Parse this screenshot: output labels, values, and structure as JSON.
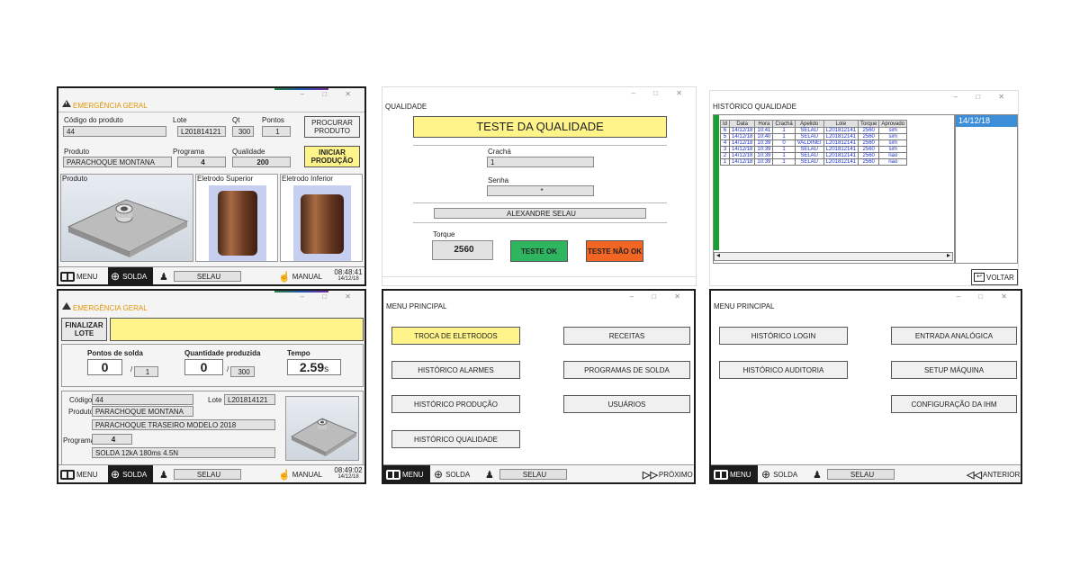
{
  "p1": {
    "alert": "EMERGÊNCIA GERAL",
    "codigo_label": "Código do produto",
    "codigo_value": "44",
    "lote_label": "Lote",
    "lote_value": "L201814121",
    "qt_label": "Qt",
    "qt_value": "300",
    "pontos_label": "Pontos",
    "pontos_value": "1",
    "procurar": "PROCURAR PRODUTO",
    "produto_label": "Produto",
    "produto_value": "PARACHOQUE MONTANA",
    "programa_label": "Programa",
    "programa_value": "4",
    "qualidade_label": "Qualidade",
    "qualidade_value": "200",
    "iniciar": "INICIAR PRODUÇÃO",
    "img_produto": "Produto",
    "img_sup": "Eletrodo Superior",
    "img_inf": "Eletrodo Inferior",
    "status": {
      "menu": "MENU",
      "solda": "SOLDA",
      "user": "SELAU",
      "manual": "MANUAL",
      "time": "08:48:41",
      "date": "14/12/18"
    }
  },
  "p2": {
    "title": "QUALIDADE",
    "heading": "TESTE DA QUALIDADE",
    "cracha_label": "Crachá",
    "cracha_value": "1",
    "senha_label": "Senha",
    "senha_value": "*",
    "name": "ALEXANDRE SELAU",
    "torque_label": "Torque",
    "torque_value": "2560",
    "teste_ok": "TESTE OK",
    "teste_nao_ok": "TESTE NÃO OK",
    "colors": {
      "ok": "#2fb560",
      "nao_ok": "#f26522",
      "heading_bg": "#fff48a"
    }
  },
  "p3": {
    "title": "HISTÓRICO QUALIDADE",
    "date_selected": "14/12/18",
    "voltar": "VOLTAR",
    "columns": [
      "Id",
      "Data",
      "Hora",
      "Crachá",
      "Apelido",
      "Lote",
      "Torque",
      "Aprovado"
    ],
    "rows": [
      [
        "6",
        "14/12/18",
        "10:41",
        "1",
        "SELAU",
        "L201812141",
        "2560",
        "sim"
      ],
      [
        "5",
        "14/12/18",
        "10:40",
        "1",
        "SELAU",
        "L201812141",
        "2560",
        "sim"
      ],
      [
        "4",
        "14/12/18",
        "10:39",
        "0",
        "VALDINEI",
        "L201812141",
        "2560",
        "sim"
      ],
      [
        "3",
        "14/12/18",
        "10:39",
        "1",
        "SELAU",
        "L201812141",
        "2560",
        "sim"
      ],
      [
        "2",
        "14/12/18",
        "10:39",
        "1",
        "SELAU",
        "L201812141",
        "2560",
        "nao"
      ],
      [
        "1",
        "14/12/18",
        "10:39",
        "1",
        "SELAU",
        "L201812141",
        "2560",
        "nao"
      ]
    ]
  },
  "p4": {
    "alert": "EMERGÊNCIA GERAL",
    "finalizar": "FINALIZAR LOTE",
    "pontos_label": "Pontos de solda",
    "pontos_value": "0",
    "pontos_total": "1",
    "qtd_label": "Quantidade produzida",
    "qtd_value": "0",
    "qtd_total": "300",
    "tempo_label": "Tempo",
    "tempo_value": "2.59",
    "tempo_unit": "s",
    "codigo_label": "Código",
    "codigo_value": "44",
    "lote_label": "Lote",
    "lote_value": "L201814121",
    "produto_label": "Produto",
    "produto_value": "PARACHOQUE MONTANA",
    "produto_desc": "PARACHOQUE TRASEIRO MODELO 2018",
    "programa_label": "Programa",
    "programa_value": "4",
    "programa_desc": "SOLDA 12kA 180ms 4.5N",
    "status": {
      "menu": "MENU",
      "solda": "SOLDA",
      "user": "SELAU",
      "manual": "MANUAL",
      "time": "08:49:02",
      "date": "14/12/18"
    }
  },
  "p5": {
    "title": "MENU PRINCIPAL",
    "left": [
      "TROCA DE ELETRODOS",
      "HISTÓRICO ALARMES",
      "HISTÓRICO PRODUÇÃO",
      "HISTÓRICO QUALIDADE"
    ],
    "right": [
      "RECEITAS",
      "PROGRAMAS DE SOLDA",
      "USUÁRIOS"
    ],
    "status": {
      "menu": "MENU",
      "solda": "SOLDA",
      "user": "SELAU",
      "next": "PRÓXIMO"
    }
  },
  "p6": {
    "title": "MENU PRINCIPAL",
    "left": [
      "HISTÓRICO LOGIN",
      "HISTÓRICO AUDITORIA"
    ],
    "right": [
      "ENTRADA ANALÓGICA",
      "SETUP MÁQUINA",
      "CONFIGURAÇÃO DA IHM"
    ],
    "status": {
      "menu": "MENU",
      "solda": "SOLDA",
      "user": "SELAU",
      "prev": "ANTERIOR"
    }
  }
}
